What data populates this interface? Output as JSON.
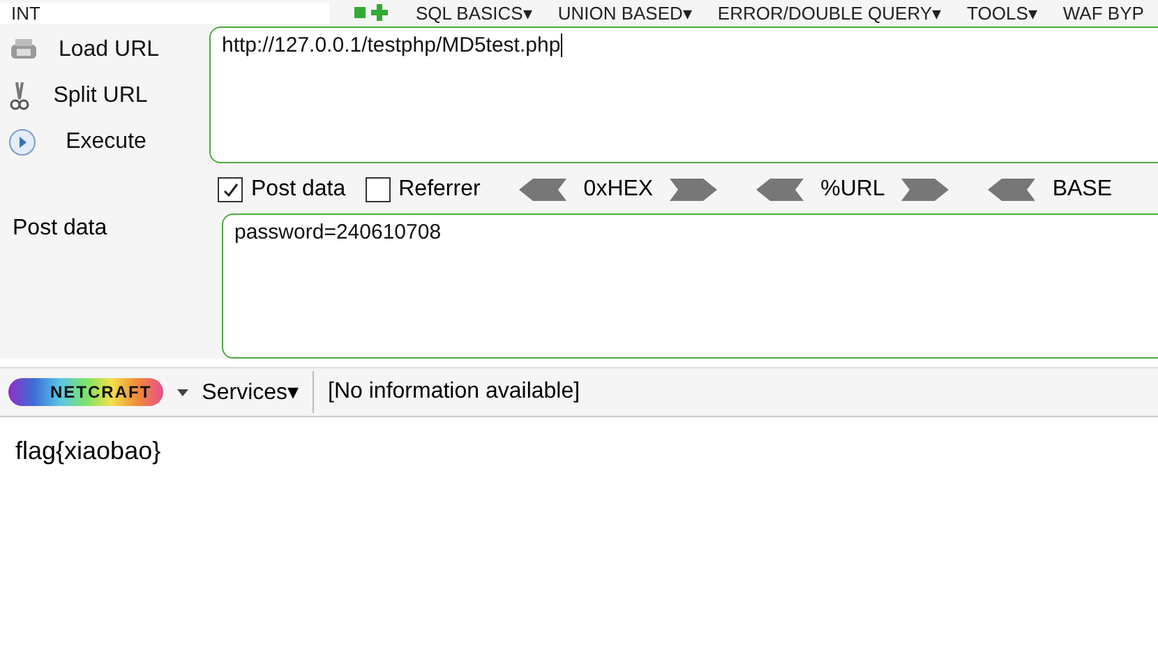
{
  "top_menu": {
    "dropdown": "INT",
    "items": [
      "SQL BASICS▾",
      "UNION BASED▾",
      "ERROR/DOUBLE QUERY▾",
      "TOOLS▾",
      "WAF BYP"
    ]
  },
  "actions": [
    {
      "kind": "load",
      "label": "Load URL"
    },
    {
      "kind": "split",
      "label": "Split URL"
    },
    {
      "kind": "execute",
      "label": "Execute"
    }
  ],
  "url_field": {
    "value": "http://127.0.0.1/testphp/MD5test.php"
  },
  "options": [
    {
      "label": "Post data",
      "checked": true
    },
    {
      "label": "Referrer",
      "checked": false
    }
  ],
  "encoders": [
    "0xHEX",
    "%URL",
    "BASE"
  ],
  "post_data": {
    "label": "Post data",
    "value": "password=240610708"
  },
  "netcraft_bar": {
    "logo": "NETCRAFT",
    "services": "Services▾",
    "info": "[No information available]"
  },
  "page_body": {
    "text": "flag{xiaobao}"
  }
}
